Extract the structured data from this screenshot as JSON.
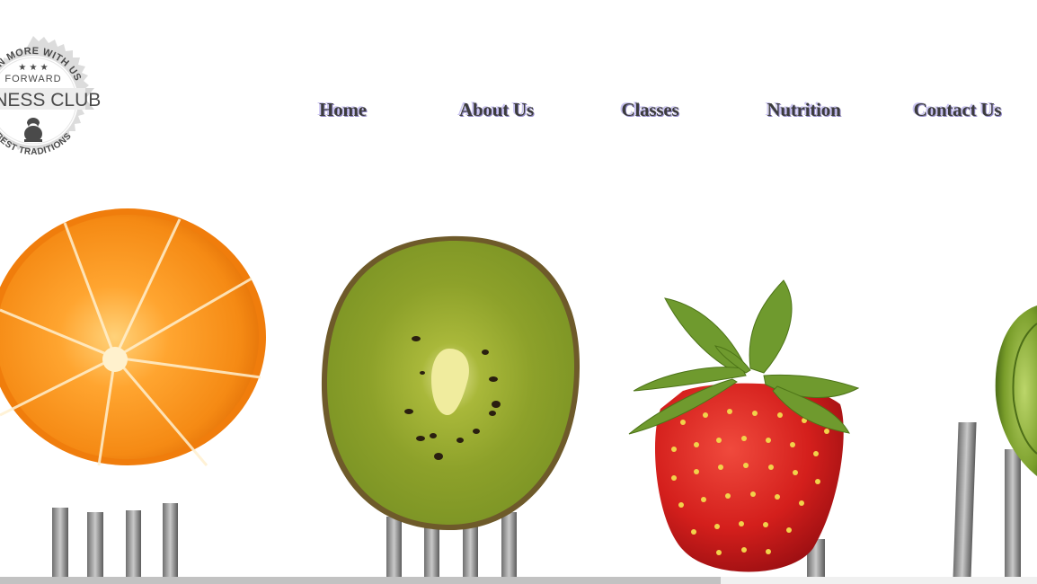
{
  "logo": {
    "arc_top": "JOIN MORE WITH US",
    "tagline": "FORWARD",
    "name": "FITNESS CLUB",
    "arc_bottom": "BEST TRADITIONS",
    "icon": "kettlebell-icon",
    "colors": {
      "badge": "#d9d9d9",
      "ink": "#4a4a4a"
    }
  },
  "nav": {
    "items": [
      {
        "label": "Home"
      },
      {
        "label": "About Us"
      },
      {
        "label": "Classes"
      },
      {
        "label": "Nutrition"
      },
      {
        "label": "Contact Us"
      }
    ],
    "colors": {
      "text": "#3c3c3c",
      "shadow": "#c9c3f0"
    }
  },
  "hero": {
    "fruits": [
      "orange",
      "kiwi",
      "strawberry",
      "brussels-sprout"
    ],
    "utensil": "fork"
  },
  "scrollbar": {
    "position_fraction": 0.695
  }
}
